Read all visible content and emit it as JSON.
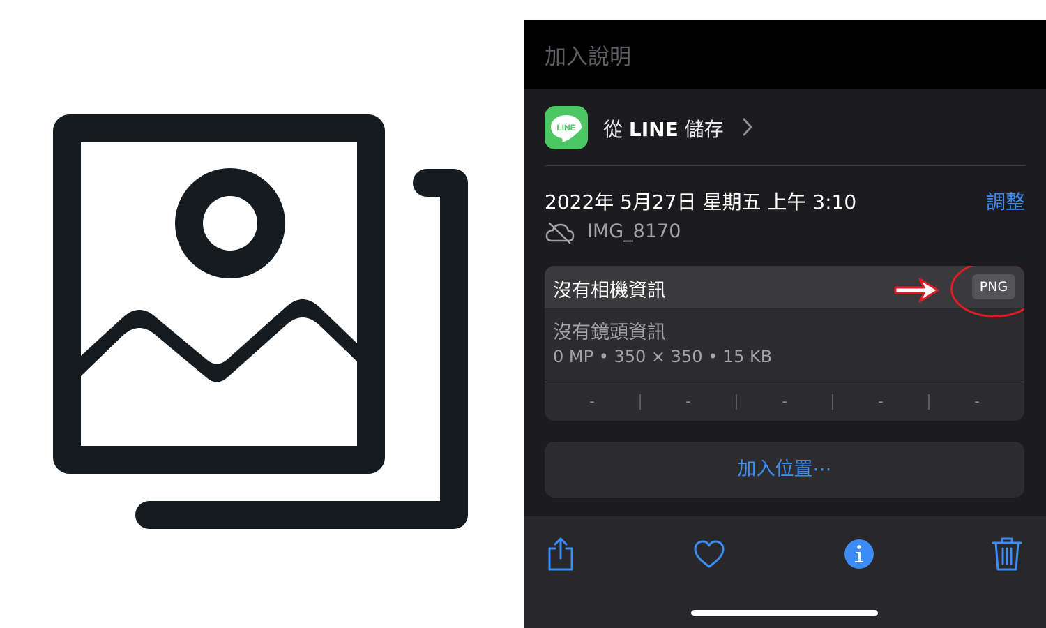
{
  "caption": {
    "placeholder": "加入說明"
  },
  "source": {
    "prefix": "從 ",
    "app": "LINE",
    "suffix": " 儲存",
    "logo_text": "LINE",
    "logo_color": "#4cc764"
  },
  "photo": {
    "datetime": "2022年 5月27日 星期五 上午 3:10",
    "adjust_label": "調整",
    "filename": "IMG_8170"
  },
  "info_card": {
    "camera": "沒有相機資訊",
    "format_badge": "PNG",
    "lens": "沒有鏡頭資訊",
    "specs": "0 MP  •  350 × 350  •  15 KB",
    "exif": [
      "-",
      "-",
      "-",
      "-",
      "-"
    ]
  },
  "add_location_label": "加入位置⋯",
  "toolbar": {
    "icons": [
      "share-icon",
      "heart-icon",
      "info-icon",
      "trash-icon"
    ]
  },
  "colors": {
    "accent": "#3b8cf7",
    "annotation": "#e01b24",
    "background": "#1c1c1e"
  }
}
